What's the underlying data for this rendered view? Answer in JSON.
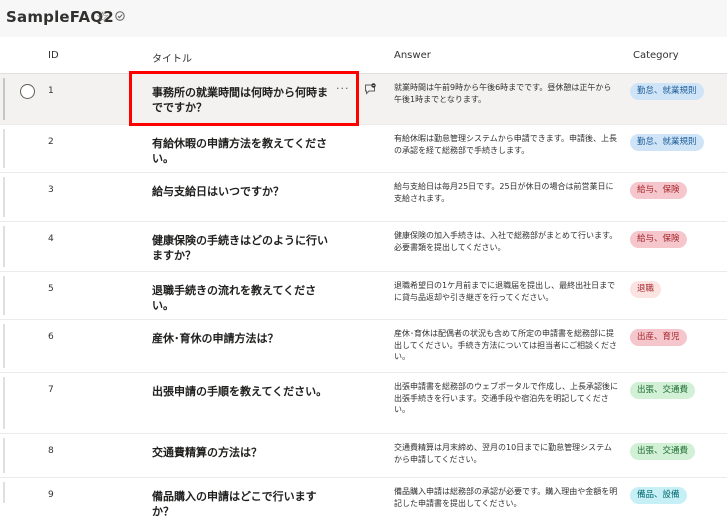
{
  "app": {
    "title": "SampleFAQ2",
    "favorite_glyph": "☆"
  },
  "columns": {
    "id": "ID",
    "title": "タイトル",
    "answer": "Answer",
    "category": "Category"
  },
  "colors": {
    "blue_pill_bg": "#cfe4f7",
    "blue_pill_fg": "#1f5e99",
    "red_pill_bg": "#f5c6cb",
    "red_pill_fg": "#a4262c",
    "pink_pill_bg": "#fbe3e1",
    "pink_pill_fg": "#a4262c",
    "green_pill_bg": "#d1f0d6",
    "green_pill_fg": "#1d6b31",
    "cyan_pill_bg": "#c6f0f5",
    "cyan_pill_fg": "#00666e",
    "highlight": "#ff0000"
  },
  "rows": [
    {
      "id": "1",
      "title": "事務所の就業時間は何時から何時までですか？",
      "answer": "就業時間は午前9時から午後6時までです。昼休憩は正午から午後1時までとなります。",
      "category": "勤怠、就業規則"
    },
    {
      "id": "2",
      "title": "有給休暇の申請方法を教えてください。",
      "answer": "有給休暇は勤怠管理システムから申請できます。申請後、上長の承認を経て総務部で手続きします。",
      "category": "勤怠、就業規則"
    },
    {
      "id": "3",
      "title": "給与支給日はいつですか？",
      "answer": "給与支給日は毎月25日です。25日が休日の場合は前営業日に支給されます。",
      "category": "給与、保険"
    },
    {
      "id": "4",
      "title": "健康保険の手続きはどのように行いますか？",
      "answer": "健康保険の加入手続きは、入社で総務部がまとめて行います。必要書類を提出してください。",
      "category": "給与、保険"
    },
    {
      "id": "5",
      "title": "退職手続きの流れを教えてください。",
      "answer": "退職希望日の1ケ月前までに退職届を提出し、最終出社日までに貸与品返却や引き継ぎを行ってください。",
      "category": "退職"
    },
    {
      "id": "6",
      "title": "産休･育休の申請方法は？",
      "answer": "産休･育休は配偶者の状況も含めて所定の申請書を総務部に提出してください。手続き方法については担当者にご相談ください。",
      "category": "出産、育児"
    },
    {
      "id": "7",
      "title": "出張申請の手順を教えてください。",
      "answer": "出張申請書を総務部のウェブポータルで作成し、上長承認後に出張手続きを行います。交通手段や宿泊先を明記してください。",
      "category": "出張、交通費"
    },
    {
      "id": "8",
      "title": "交通費精算の方法は？",
      "answer": "交通費精算は月末締め、翌月の10日までに勤怠管理システムから申請してください。",
      "category": "出張、交通費"
    },
    {
      "id": "9",
      "title": "備品購入の申請はどこで行いますか？",
      "answer": "備品購入申請は総務部の承認が必要です。購入理由や金額を明記した申請書を提出してください。",
      "category": "備品、設備"
    }
  ]
}
